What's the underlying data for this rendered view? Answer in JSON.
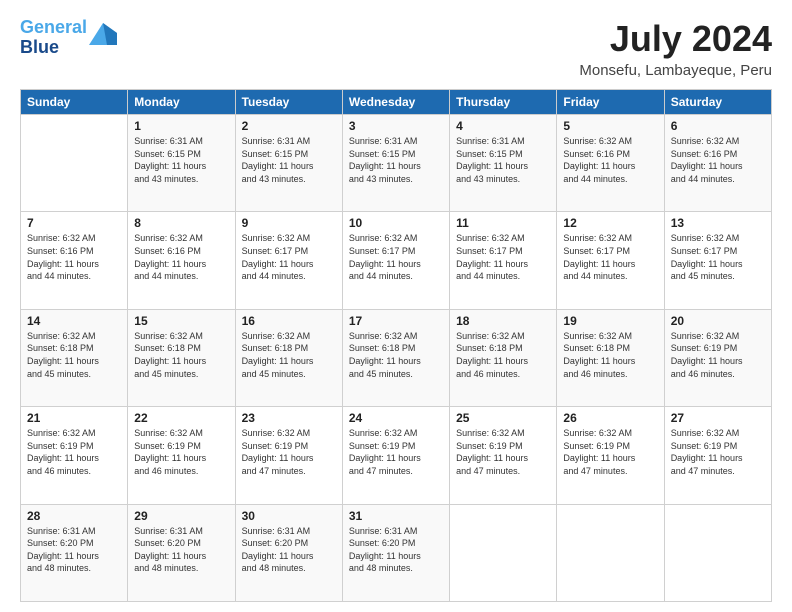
{
  "header": {
    "logo_line1": "General",
    "logo_line2": "Blue",
    "month_year": "July 2024",
    "location": "Monsefu, Lambayeque, Peru"
  },
  "days_of_week": [
    "Sunday",
    "Monday",
    "Tuesday",
    "Wednesday",
    "Thursday",
    "Friday",
    "Saturday"
  ],
  "weeks": [
    [
      {
        "num": "",
        "info": ""
      },
      {
        "num": "1",
        "info": "Sunrise: 6:31 AM\nSunset: 6:15 PM\nDaylight: 11 hours\nand 43 minutes."
      },
      {
        "num": "2",
        "info": "Sunrise: 6:31 AM\nSunset: 6:15 PM\nDaylight: 11 hours\nand 43 minutes."
      },
      {
        "num": "3",
        "info": "Sunrise: 6:31 AM\nSunset: 6:15 PM\nDaylight: 11 hours\nand 43 minutes."
      },
      {
        "num": "4",
        "info": "Sunrise: 6:31 AM\nSunset: 6:15 PM\nDaylight: 11 hours\nand 43 minutes."
      },
      {
        "num": "5",
        "info": "Sunrise: 6:32 AM\nSunset: 6:16 PM\nDaylight: 11 hours\nand 44 minutes."
      },
      {
        "num": "6",
        "info": "Sunrise: 6:32 AM\nSunset: 6:16 PM\nDaylight: 11 hours\nand 44 minutes."
      }
    ],
    [
      {
        "num": "7",
        "info": "Sunrise: 6:32 AM\nSunset: 6:16 PM\nDaylight: 11 hours\nand 44 minutes."
      },
      {
        "num": "8",
        "info": "Sunrise: 6:32 AM\nSunset: 6:16 PM\nDaylight: 11 hours\nand 44 minutes."
      },
      {
        "num": "9",
        "info": "Sunrise: 6:32 AM\nSunset: 6:17 PM\nDaylight: 11 hours\nand 44 minutes."
      },
      {
        "num": "10",
        "info": "Sunrise: 6:32 AM\nSunset: 6:17 PM\nDaylight: 11 hours\nand 44 minutes."
      },
      {
        "num": "11",
        "info": "Sunrise: 6:32 AM\nSunset: 6:17 PM\nDaylight: 11 hours\nand 44 minutes."
      },
      {
        "num": "12",
        "info": "Sunrise: 6:32 AM\nSunset: 6:17 PM\nDaylight: 11 hours\nand 44 minutes."
      },
      {
        "num": "13",
        "info": "Sunrise: 6:32 AM\nSunset: 6:17 PM\nDaylight: 11 hours\nand 45 minutes."
      }
    ],
    [
      {
        "num": "14",
        "info": "Sunrise: 6:32 AM\nSunset: 6:18 PM\nDaylight: 11 hours\nand 45 minutes."
      },
      {
        "num": "15",
        "info": "Sunrise: 6:32 AM\nSunset: 6:18 PM\nDaylight: 11 hours\nand 45 minutes."
      },
      {
        "num": "16",
        "info": "Sunrise: 6:32 AM\nSunset: 6:18 PM\nDaylight: 11 hours\nand 45 minutes."
      },
      {
        "num": "17",
        "info": "Sunrise: 6:32 AM\nSunset: 6:18 PM\nDaylight: 11 hours\nand 45 minutes."
      },
      {
        "num": "18",
        "info": "Sunrise: 6:32 AM\nSunset: 6:18 PM\nDaylight: 11 hours\nand 46 minutes."
      },
      {
        "num": "19",
        "info": "Sunrise: 6:32 AM\nSunset: 6:18 PM\nDaylight: 11 hours\nand 46 minutes."
      },
      {
        "num": "20",
        "info": "Sunrise: 6:32 AM\nSunset: 6:19 PM\nDaylight: 11 hours\nand 46 minutes."
      }
    ],
    [
      {
        "num": "21",
        "info": "Sunrise: 6:32 AM\nSunset: 6:19 PM\nDaylight: 11 hours\nand 46 minutes."
      },
      {
        "num": "22",
        "info": "Sunrise: 6:32 AM\nSunset: 6:19 PM\nDaylight: 11 hours\nand 46 minutes."
      },
      {
        "num": "23",
        "info": "Sunrise: 6:32 AM\nSunset: 6:19 PM\nDaylight: 11 hours\nand 47 minutes."
      },
      {
        "num": "24",
        "info": "Sunrise: 6:32 AM\nSunset: 6:19 PM\nDaylight: 11 hours\nand 47 minutes."
      },
      {
        "num": "25",
        "info": "Sunrise: 6:32 AM\nSunset: 6:19 PM\nDaylight: 11 hours\nand 47 minutes."
      },
      {
        "num": "26",
        "info": "Sunrise: 6:32 AM\nSunset: 6:19 PM\nDaylight: 11 hours\nand 47 minutes."
      },
      {
        "num": "27",
        "info": "Sunrise: 6:32 AM\nSunset: 6:19 PM\nDaylight: 11 hours\nand 47 minutes."
      }
    ],
    [
      {
        "num": "28",
        "info": "Sunrise: 6:31 AM\nSunset: 6:20 PM\nDaylight: 11 hours\nand 48 minutes."
      },
      {
        "num": "29",
        "info": "Sunrise: 6:31 AM\nSunset: 6:20 PM\nDaylight: 11 hours\nand 48 minutes."
      },
      {
        "num": "30",
        "info": "Sunrise: 6:31 AM\nSunset: 6:20 PM\nDaylight: 11 hours\nand 48 minutes."
      },
      {
        "num": "31",
        "info": "Sunrise: 6:31 AM\nSunset: 6:20 PM\nDaylight: 11 hours\nand 48 minutes."
      },
      {
        "num": "",
        "info": ""
      },
      {
        "num": "",
        "info": ""
      },
      {
        "num": "",
        "info": ""
      }
    ]
  ]
}
